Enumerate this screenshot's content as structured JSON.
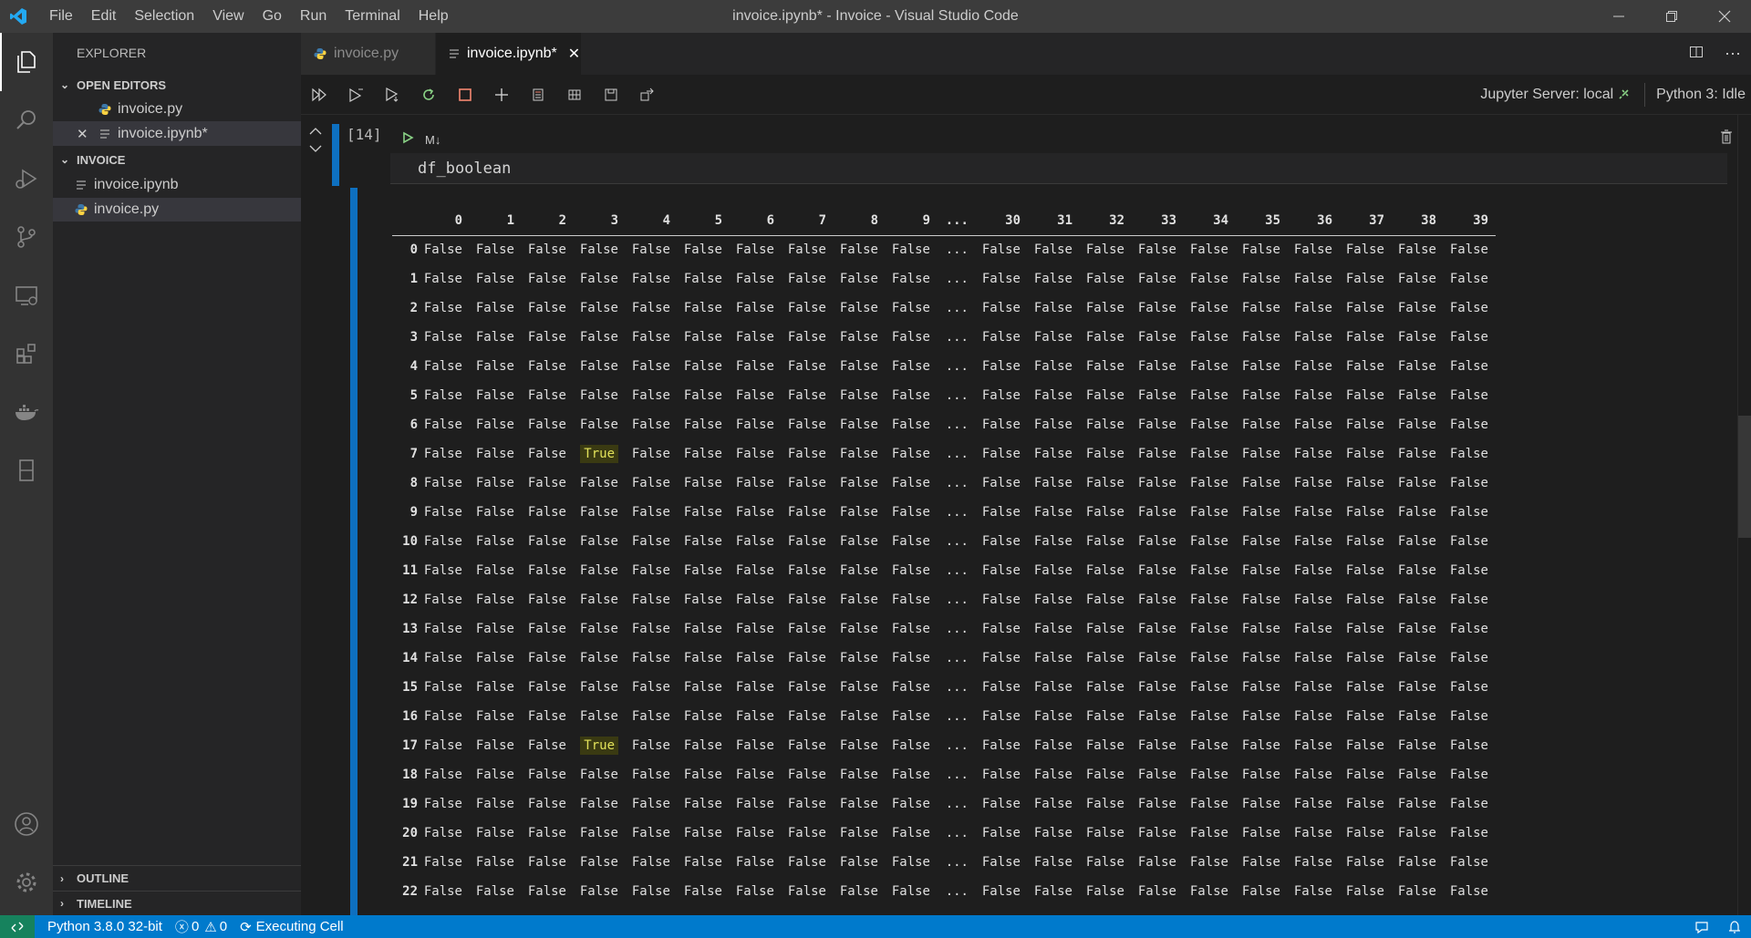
{
  "window": {
    "title": "invoice.ipynb* - Invoice - Visual Studio Code",
    "menu": [
      "File",
      "Edit",
      "Selection",
      "View",
      "Go",
      "Run",
      "Terminal",
      "Help"
    ]
  },
  "sidebar": {
    "title": "EXPLORER",
    "open_editors_label": "OPEN EDITORS",
    "open_editors": [
      "invoice.py",
      "invoice.ipynb*"
    ],
    "folder_label": "INVOICE",
    "files": [
      "invoice.ipynb",
      "invoice.py"
    ],
    "outline_label": "OUTLINE",
    "timeline_label": "TIMELINE"
  },
  "tabs": [
    {
      "label": "invoice.py",
      "icon": "python-icon"
    },
    {
      "label": "invoice.ipynb*",
      "icon": "notebook-icon"
    }
  ],
  "toolbar": {
    "server_label": "Jupyter Server: local",
    "kernel_label": "Python 3: Idle"
  },
  "cell": {
    "exec_count": "[14]",
    "type_label": "M↓",
    "code": "df_boolean"
  },
  "output": {
    "columns": [
      "0",
      "1",
      "2",
      "3",
      "4",
      "5",
      "6",
      "7",
      "8",
      "9",
      "...",
      "30",
      "31",
      "32",
      "33",
      "34",
      "35",
      "36",
      "37",
      "38",
      "39"
    ],
    "rows": [
      {
        "index": "0",
        "true_cols": []
      },
      {
        "index": "1",
        "true_cols": []
      },
      {
        "index": "2",
        "true_cols": []
      },
      {
        "index": "3",
        "true_cols": []
      },
      {
        "index": "4",
        "true_cols": []
      },
      {
        "index": "5",
        "true_cols": []
      },
      {
        "index": "6",
        "true_cols": []
      },
      {
        "index": "7",
        "true_cols": [
          "3"
        ]
      },
      {
        "index": "8",
        "true_cols": []
      },
      {
        "index": "9",
        "true_cols": []
      },
      {
        "index": "10",
        "true_cols": []
      },
      {
        "index": "11",
        "true_cols": []
      },
      {
        "index": "12",
        "true_cols": []
      },
      {
        "index": "13",
        "true_cols": []
      },
      {
        "index": "14",
        "true_cols": []
      },
      {
        "index": "15",
        "true_cols": []
      },
      {
        "index": "16",
        "true_cols": []
      },
      {
        "index": "17",
        "true_cols": [
          "3"
        ]
      },
      {
        "index": "18",
        "true_cols": []
      },
      {
        "index": "19",
        "true_cols": []
      },
      {
        "index": "20",
        "true_cols": []
      },
      {
        "index": "21",
        "true_cols": []
      },
      {
        "index": "22",
        "true_cols": []
      }
    ],
    "false_text": "False",
    "true_text": "True",
    "ellipsis_text": "..."
  },
  "statusbar": {
    "interpreter": "Python 3.8.0 32-bit",
    "errors": "0",
    "warnings": "0",
    "activity": "Executing Cell"
  },
  "colors": {
    "accent": "#007acc",
    "cell_bar": "#0e70c0",
    "true_highlight": "#e2e25a"
  }
}
